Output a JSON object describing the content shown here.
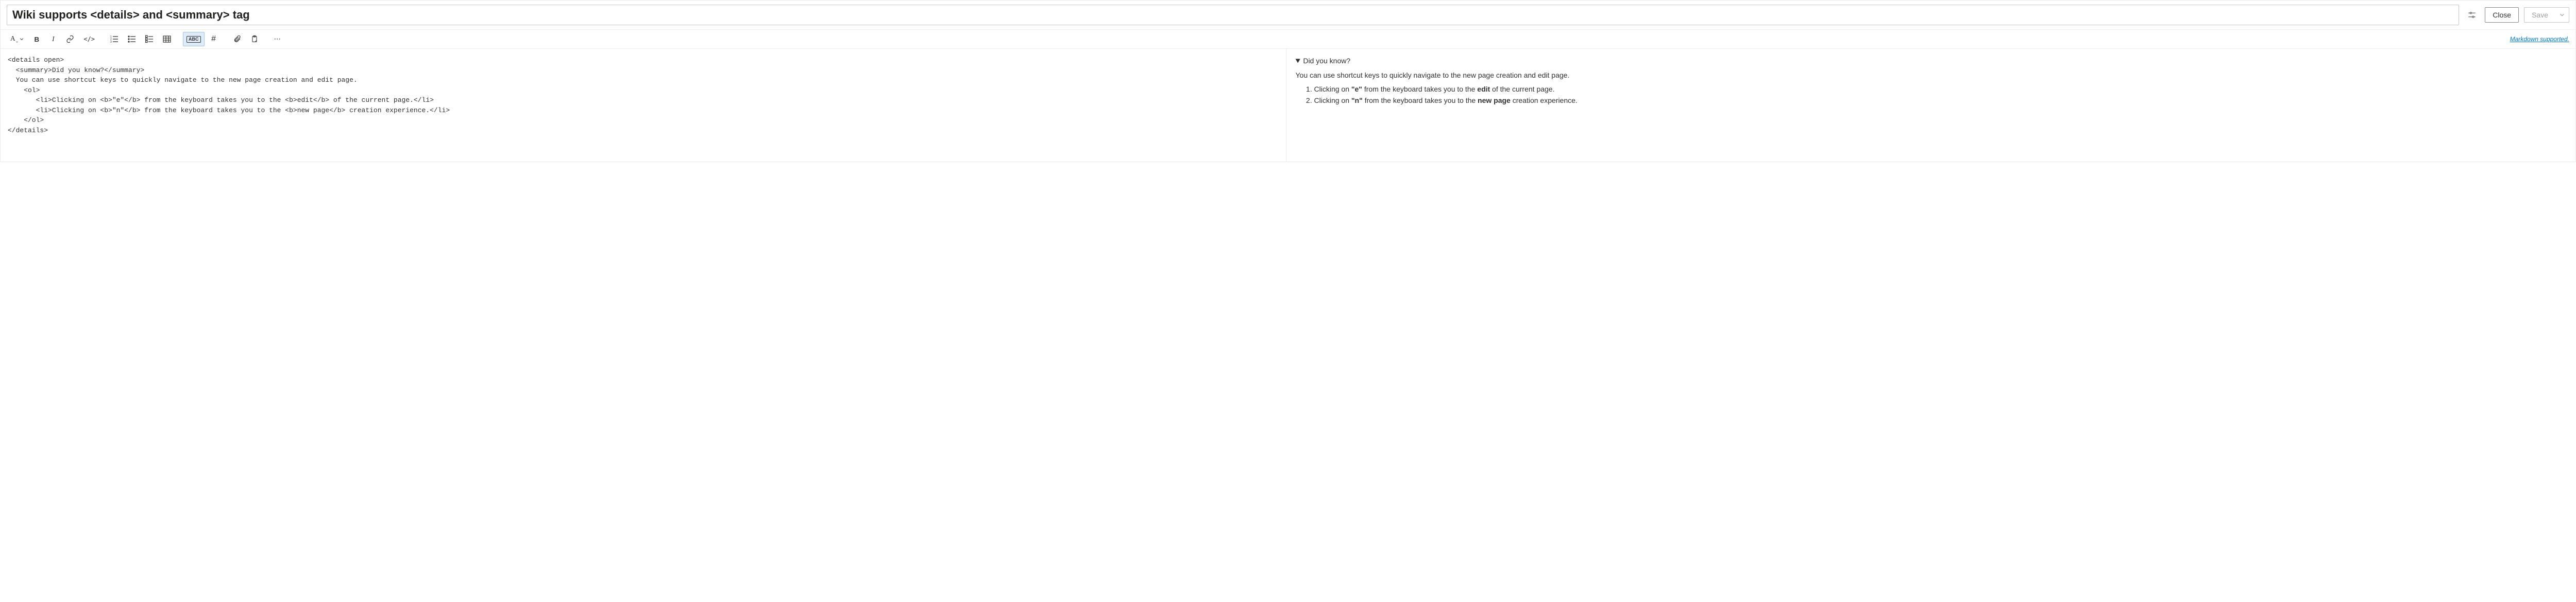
{
  "header": {
    "title": "Wiki supports <details> and <summary> tag",
    "settings_icon": "settings",
    "close_label": "Close",
    "save_label": "Save"
  },
  "toolbar": {
    "format_text": "A",
    "bold": "B",
    "italic": "I",
    "link": "link",
    "code": "</>",
    "ol": "ol",
    "ul": "ul",
    "checklist": "checklist",
    "table": "table",
    "paragraph_mark": "ABC",
    "hash": "#",
    "attach": "attach",
    "paste": "paste",
    "more": "⋯",
    "md_supported": "Markdown supported."
  },
  "editor": {
    "source": "<details open>\n  <summary>Did you know?</summary>\n  You can use shortcut keys to quickly navigate to the new page creation and edit page.\n    <ol>\n       <li>Clicking on <b>\"e\"</b> from the keyboard takes you to the <b>edit</b> of the current page.</li>\n       <li>Clicking on <b>\"n\"</b> from the keyboard takes you to the <b>new page</b> creation experience.</li>\n    </ol>\n</details>"
  },
  "preview": {
    "summary": "Did you know?",
    "intro": "You can use shortcut keys to quickly navigate to the new page creation and edit page.",
    "items": [
      {
        "pre": "Clicking on ",
        "key": "\"e\"",
        "mid": " from the keyboard takes you to the ",
        "bold": "edit",
        "post": " of the current page."
      },
      {
        "pre": "Clicking on ",
        "key": "\"n\"",
        "mid": " from the keyboard takes you to the ",
        "bold": "new page",
        "post": " creation experience."
      }
    ]
  }
}
